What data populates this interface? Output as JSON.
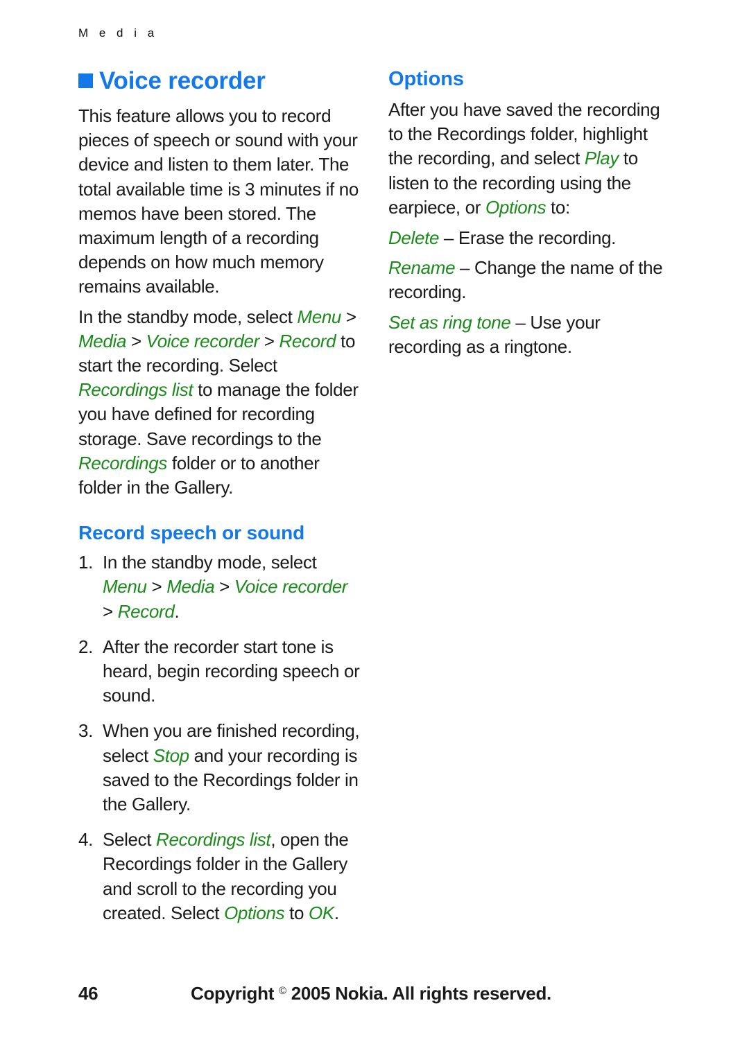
{
  "running_head": "M e d i a",
  "colors": {
    "heading_blue": "#1479e8",
    "ui_term_green": "#1a8a1a",
    "body_black": "#1a1a1a",
    "page_background": "#ffffff"
  },
  "left_column": {
    "chapter_title": "Voice recorder",
    "intro_paragraph": "This feature allows you to record pieces of speech or sound with your device and listen to them later. The total available time is 3 minutes if no memos have been stored. The maximum length of a recording depends on how much memory remains available.",
    "path_paragraph": {
      "part1": "In the standby mode, select ",
      "term1": "Menu",
      "sep1": " > ",
      "term2": "Media",
      "sep2": " > ",
      "term3": "Voice recorder",
      "sep3": " > ",
      "term4": "Record",
      "part2": " to start the recording. Select ",
      "term5": "Recordings list",
      "part3": " to manage the folder you have defined for recording storage. Save recordings to the ",
      "term6": "Recordings",
      "part4": " folder or to another folder in the Gallery."
    },
    "subsection_title": "Record speech or sound",
    "steps": [
      {
        "number": "1.",
        "part1": "In the standby mode, select ",
        "term1": "Menu",
        "sep1": " > ",
        "term2": "Media",
        "sep2": " > ",
        "term3": "Voice recorder",
        "sep3": " > ",
        "term4": "Record",
        "part2": "."
      },
      {
        "number": "2.",
        "part1": "After the recorder start tone is heard, begin recording speech or sound.",
        "term1": "",
        "part2": ""
      },
      {
        "number": "3.",
        "part1": "When you are finished recording, select ",
        "term1": "Stop",
        "part2": " and your recording is saved to the Recordings folder in the Gallery."
      },
      {
        "number": "4.",
        "part1": "Select ",
        "term1": "Recordings list",
        "part2": ", open the Recordings folder in the Gallery and scroll to the recording you created. Select ",
        "term2": "Options",
        "part3": " to ",
        "term3": "OK",
        "part4": "."
      }
    ]
  },
  "right_column": {
    "section_title": "Options",
    "intro_paragraph": {
      "part1": "After you have saved the recording to the Recordings folder, highlight the recording, and select ",
      "term1": "Play",
      "part2": " to listen to the recording using the earpiece, or ",
      "term2": "Options",
      "part3": " to:"
    },
    "options": [
      {
        "term": "Delete",
        "dash": " – ",
        "description": "Erase the recording."
      },
      {
        "term": "Rename",
        "dash": " – ",
        "description": "Change the name of the recording."
      },
      {
        "term": "Set as ring tone",
        "dash": " – ",
        "description": "Use your recording as a ringtone."
      }
    ]
  },
  "footer": {
    "page_number": "46",
    "copyright_prefix": "Copyright ",
    "copyright_symbol": "©",
    "copyright_suffix": " 2005 Nokia. All rights reserved."
  }
}
